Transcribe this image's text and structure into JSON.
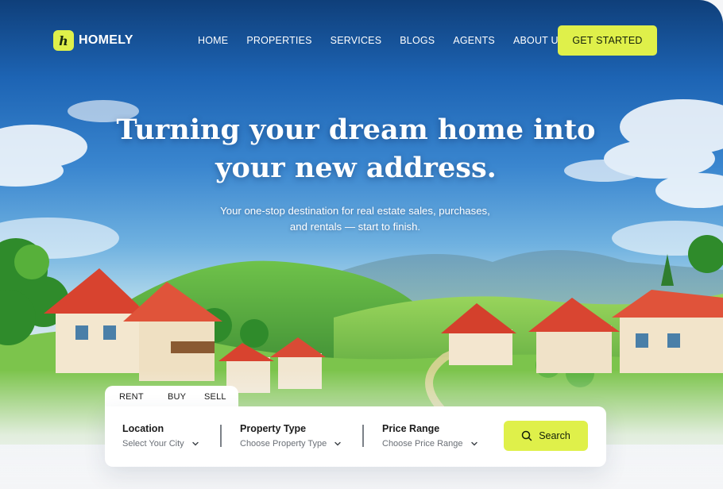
{
  "brand": {
    "logo_letter": "h",
    "name": "HOMELY",
    "accent": "#dff04a"
  },
  "nav": {
    "items": [
      "HOME",
      "PROPERTIES",
      "SERVICES",
      "BLOGS",
      "AGENTS",
      "ABOUT US"
    ],
    "cta": "GET STARTED"
  },
  "hero": {
    "headline_line1": "Turning your dream home into",
    "headline_line2": "your new address.",
    "sub_line1": "Your one-stop destination for real estate sales, purchases,",
    "sub_line2": "and rentals — start to finish."
  },
  "search": {
    "tabs": [
      "RENT",
      "BUY",
      "SELL"
    ],
    "selected_tab": "RENT",
    "fields": [
      {
        "label": "Location",
        "value": "Select Your City"
      },
      {
        "label": "Property Type",
        "value": "Choose Property Type"
      },
      {
        "label": "Price Range",
        "value": "Choose Price Range"
      }
    ],
    "button": "Search"
  }
}
